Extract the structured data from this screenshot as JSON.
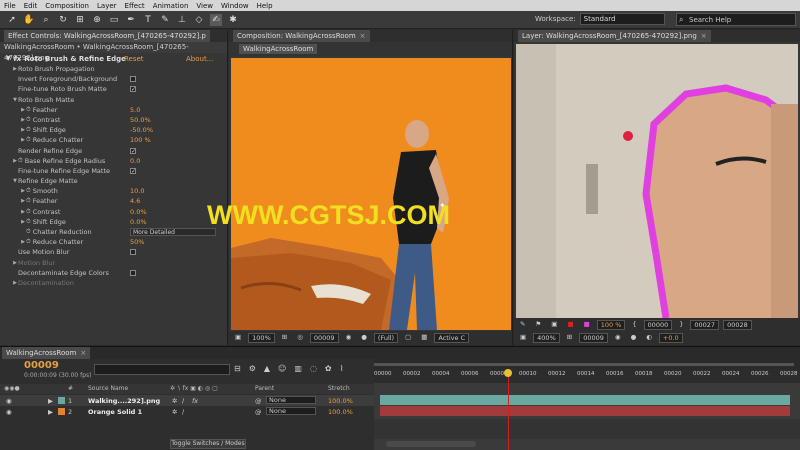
{
  "menu": [
    "File",
    "Edit",
    "Composition",
    "Layer",
    "Effect",
    "Animation",
    "View",
    "Window",
    "Help"
  ],
  "toolbar": {
    "workspace_label": "Workspace:",
    "workspace_value": "Standard",
    "search_placeholder": "Search Help"
  },
  "effect_controls": {
    "tab": "Effect Controls: WalkingAcrossRoom_[470265-470292].p",
    "subtitle": "WalkingAcrossRoom • WalkingAcrossRoom_[470265-470292].png",
    "effect_name": "Roto Brush & Refine Edge",
    "reset": "Reset",
    "about": "About...",
    "rows": [
      {
        "label": "Roto Brush Propagation",
        "indent": 1,
        "tw": "▶"
      },
      {
        "label": "Invert Foreground/Background",
        "indent": 1,
        "check": ""
      },
      {
        "label": "Fine-tune Roto Brush Matte",
        "indent": 1,
        "check": "✓"
      },
      {
        "label": "Roto Brush Matte",
        "indent": 1,
        "tw": "▼"
      },
      {
        "label": "Feather",
        "indent": 2,
        "tw": "▶",
        "stopwatch": true,
        "value": "5.0"
      },
      {
        "label": "Contrast",
        "indent": 2,
        "tw": "▶",
        "stopwatch": true,
        "value": "50.0%"
      },
      {
        "label": "Shift Edge",
        "indent": 2,
        "tw": "▶",
        "stopwatch": true,
        "value": "-50.0%"
      },
      {
        "label": "Reduce Chatter",
        "indent": 2,
        "tw": "▶",
        "stopwatch": true,
        "value": "100 %"
      },
      {
        "label": "Render Refine Edge",
        "indent": 1,
        "check": "✓"
      },
      {
        "label": "Base Refine Edge Radius",
        "indent": 1,
        "tw": "▶",
        "stopwatch": true,
        "value": "0.0"
      },
      {
        "label": "Fine-tune Refine Edge Matte",
        "indent": 1,
        "check": "✓"
      },
      {
        "label": "Refine Edge Matte",
        "indent": 1,
        "tw": "▼"
      },
      {
        "label": "Smooth",
        "indent": 2,
        "tw": "▶",
        "stopwatch": true,
        "value": "10.0"
      },
      {
        "label": "Feather",
        "indent": 2,
        "tw": "▶",
        "stopwatch": true,
        "value": "4.6"
      },
      {
        "label": "Contrast",
        "indent": 2,
        "tw": "▶",
        "stopwatch": true,
        "value": "0.0%"
      },
      {
        "label": "Shift Edge",
        "indent": 2,
        "tw": "▶",
        "stopwatch": true,
        "value": "0.0%"
      },
      {
        "label": "Chatter Reduction",
        "indent": 2,
        "stopwatch": true,
        "dropdown": "More Detailed"
      },
      {
        "label": "Reduce Chatter",
        "indent": 2,
        "tw": "▶",
        "stopwatch": true,
        "value": "50%"
      },
      {
        "label": "Use Motion Blur",
        "indent": 1,
        "check": ""
      },
      {
        "label": "Motion Blur",
        "indent": 1,
        "tw": "▶",
        "dim": true
      },
      {
        "label": "Decontaminate Edge Colors",
        "indent": 1,
        "check": ""
      },
      {
        "label": "Decontamination",
        "indent": 1,
        "tw": "▶",
        "dim": true
      }
    ]
  },
  "composition": {
    "tab": "Composition: WalkingAcrossRoom",
    "comp_tab": "WalkingAcrossRoom",
    "zoom": "100%",
    "timecode": "00009",
    "resolution": "(Full)",
    "active_camera": "Active C"
  },
  "layer_panel": {
    "tab": "Layer: WalkingAcrossRoom_[470265-470292].png",
    "ruler": [
      "00005",
      "00010",
      "00015",
      "00020",
      "00025"
    ],
    "zoom": "400%",
    "timecode": "00009",
    "mag": "100 %",
    "start": "00000",
    "duration": "00027",
    "end": "00028",
    "offset": "+0.0"
  },
  "timeline": {
    "tab": "WalkingAcrossRoom",
    "timecode": "00009",
    "fps": "0:00:00:09 (30.00 fps)",
    "columns": {
      "num": "#",
      "source": "Source Name",
      "parent": "Parent",
      "stretch": "Stretch"
    },
    "ruler": [
      "00000",
      "00002",
      "00004",
      "00006",
      "00008",
      "00010",
      "00012",
      "00014",
      "00016",
      "00018",
      "00020",
      "00022",
      "00024",
      "00026",
      "00028"
    ],
    "layers": [
      {
        "num": "1",
        "name": "Walking....292].png",
        "parent": "None",
        "stretch": "100.0%",
        "color": "#6aa8a0"
      },
      {
        "num": "2",
        "name": "Orange Solid 1",
        "parent": "None",
        "stretch": "100.0%",
        "color": "#a23b3b"
      }
    ],
    "toggle_label": "Toggle Switches / Modes"
  },
  "watermark": "WWW.CGTSJ.COM",
  "colors": {
    "accent": "#e8a040",
    "comp_bg": "#f08c1e",
    "matte_edge": "#e040e0"
  }
}
